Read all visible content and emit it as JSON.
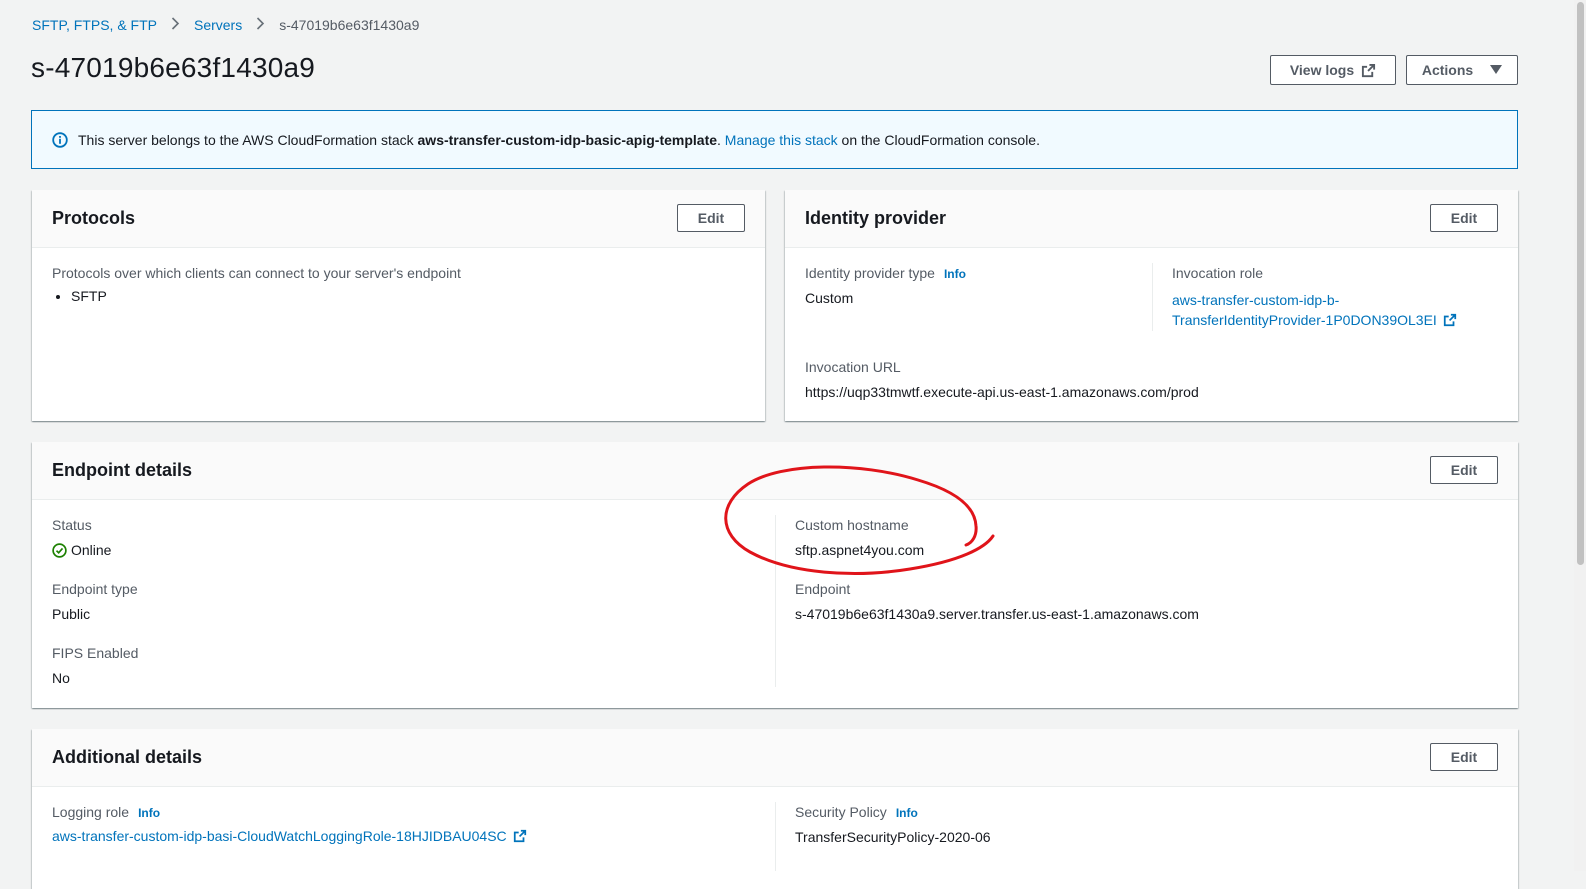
{
  "breadcrumb": {
    "items": [
      "SFTP, FTPS, & FTP",
      "Servers"
    ],
    "current": "s-47019b6e63f1430a9"
  },
  "page": {
    "title": "s-47019b6e63f1430a9",
    "view_logs_label": "View logs",
    "actions_label": "Actions"
  },
  "alert": {
    "prefix": "This server belongs to the AWS CloudFormation stack ",
    "stack_name": "aws-transfer-custom-idp-basic-apig-template",
    "period": ".",
    "link_text": "Manage this stack",
    "suffix": " on the CloudFormation console."
  },
  "protocols": {
    "title": "Protocols",
    "edit_label": "Edit",
    "description": "Protocols over which clients can connect to your server's endpoint",
    "items": [
      "SFTP"
    ]
  },
  "identity": {
    "title": "Identity provider",
    "edit_label": "Edit",
    "type_label": "Identity provider type",
    "info_label": "Info",
    "type_value": "Custom",
    "role_label": "Invocation role",
    "role_value_line1": "aws-transfer-custom-idp-b-",
    "role_value_line2": "TransferIdentityProvider-1P0DON39OL3EI",
    "url_label": "Invocation URL",
    "url_value": "https://uqp33tmwtf.execute-api.us-east-1.amazonaws.com/prod"
  },
  "endpoint": {
    "title": "Endpoint details",
    "edit_label": "Edit",
    "status_label": "Status",
    "status_value": "Online",
    "type_label": "Endpoint type",
    "type_value": "Public",
    "fips_label": "FIPS Enabled",
    "fips_value": "No",
    "hostname_label": "Custom hostname",
    "hostname_value": "sftp.aspnet4you.com",
    "endpoint_label": "Endpoint",
    "endpoint_value": "s-47019b6e63f1430a9.server.transfer.us-east-1.amazonaws.com"
  },
  "additional": {
    "title": "Additional details",
    "edit_label": "Edit",
    "logging_label": "Logging role",
    "info_label": "Info",
    "logging_value": "aws-transfer-custom-idp-basi-CloudWatchLoggingRole-18HJIDBAU04SC",
    "security_label": "Security Policy",
    "security_info_label": "Info",
    "security_value": "TransferSecurityPolicy-2020-06"
  },
  "colors": {
    "link": "#0073bb",
    "success": "#1d8102",
    "annotation": "#e0141a",
    "alert_bg": "#f1faff"
  },
  "icons": [
    "chevron-right-icon",
    "external-link-icon",
    "caret-down-icon",
    "info-circle-icon",
    "status-success-icon"
  ]
}
